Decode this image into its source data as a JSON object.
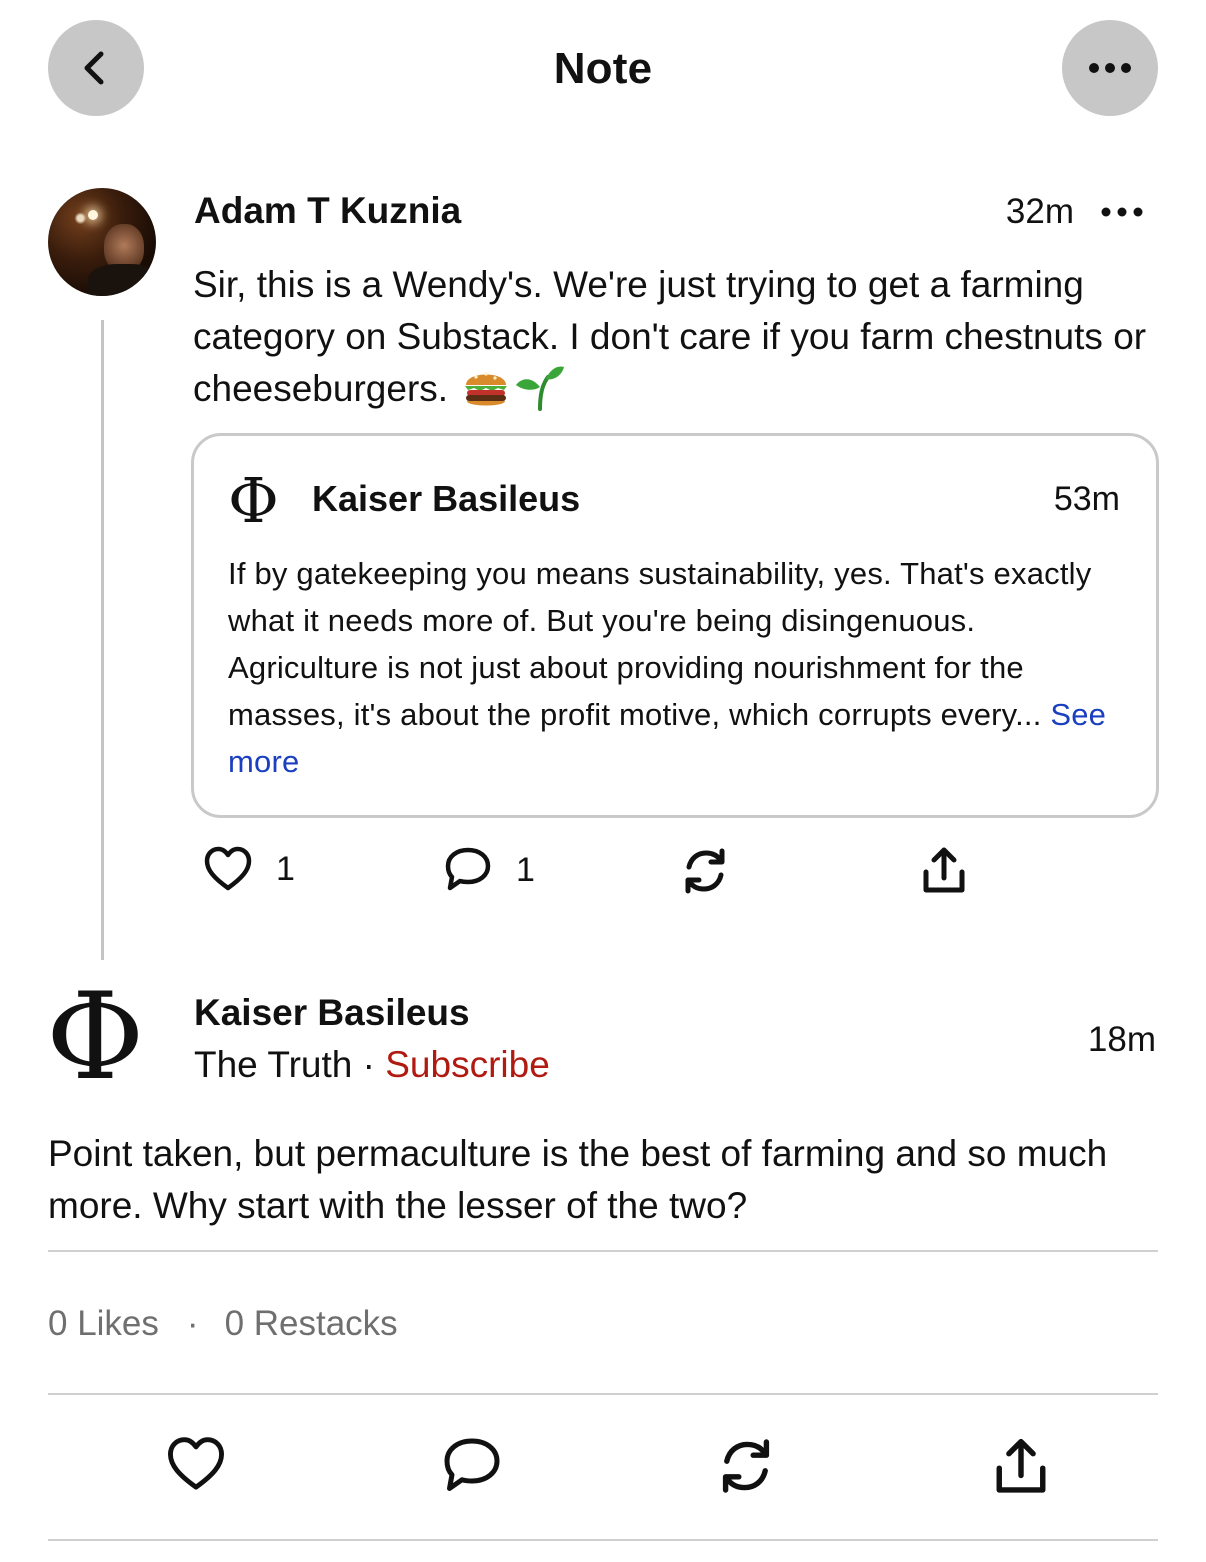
{
  "header": {
    "title": "Note",
    "back_icon": "chevron-left-icon",
    "more_icon": "ellipsis-icon"
  },
  "parent_note": {
    "author": "Adam T Kuznia",
    "time": "32m",
    "body": "Sir, this is a Wendy's. We're just trying to get a farming category on Substack. I don't care if you farm chestnuts or cheeseburgers.",
    "emojis": [
      "burger-emoji",
      "seedling-emoji"
    ],
    "quote": {
      "logo": "Φ",
      "author": "Kaiser Basileus",
      "time": "53m",
      "text": "If by gatekeeping you means sustainability, yes.  That's exactly what it needs more of.  But you're being disingenuous.  Agriculture is not just about providing nourishment for the masses, it's about the profit motive, which corrupts every...",
      "see_more": "See more"
    },
    "actions": {
      "likes": "1",
      "comments": "1"
    }
  },
  "main_note": {
    "logo": "Φ",
    "author": "Kaiser Basileus",
    "publication": "The Truth",
    "separator": " · ",
    "subscribe": "Subscribe",
    "time": "18m",
    "body": "Point taken, but permaculture is the best of farming and so much more.  Why start with the lesser of the two?",
    "likes_label": "0 Likes",
    "stats_dot": "·",
    "restacks_label": "0 Restacks"
  },
  "colors": {
    "subscribe": "#b01a10",
    "see_more": "#1a3fc0",
    "header_button_bg": "#c7c7c7",
    "divider": "#d0d0d0",
    "stats_text": "#6f6f6f"
  }
}
